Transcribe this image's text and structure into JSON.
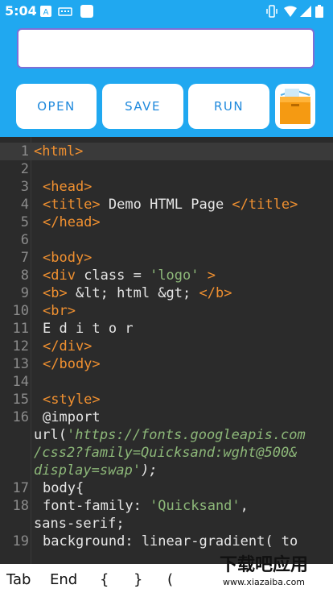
{
  "status": {
    "time": "5:04"
  },
  "url_input": {
    "value": "",
    "placeholder": ""
  },
  "buttons": [
    {
      "label": "OPEN"
    },
    {
      "label": "SAVE"
    },
    {
      "label": "RUN"
    }
  ],
  "editor": {
    "lines": [
      {
        "n": "1"
      },
      {
        "n": "2"
      },
      {
        "n": "3"
      },
      {
        "n": "4"
      },
      {
        "n": "5"
      },
      {
        "n": "6"
      },
      {
        "n": "7"
      },
      {
        "n": "8"
      },
      {
        "n": "9"
      },
      {
        "n": "10"
      },
      {
        "n": "11"
      },
      {
        "n": "12"
      },
      {
        "n": "13"
      },
      {
        "n": "14"
      },
      {
        "n": "15"
      },
      {
        "n": "16"
      },
      {
        "n": "17"
      },
      {
        "n": "18"
      },
      {
        "n": "19"
      }
    ],
    "code": {
      "l1": "<html>",
      "l3": "<head>",
      "l4a": "<title>",
      "l4b": " Demo HTML Page ",
      "l4c": "</title>",
      "l5": "</head>",
      "l7": "<body>",
      "l8a": "<div",
      "l8b": " class = ",
      "l8c": "'logo'",
      "l8d": " >",
      "l9a": "<b>",
      "l9b": " &lt; html &gt; ",
      "l9c": "</b>",
      "l10": "<br>",
      "l11": "E d i t o r",
      "l12": "</div>",
      "l13": "</body>",
      "l15": "<style>",
      "l16a": "@import",
      "l16b": "url(",
      "l16c": "'https://fonts.googleapis.com",
      "l16d": "/css2?family=Quicksand:wght@500&",
      "l16e": "display=swap'",
      "l16f": ");",
      "l17": "body{",
      "l18a": "font-family: ",
      "l18b": "'Quicksand'",
      "l18c": ",",
      "l18d": "sans-serif;",
      "l19": "background: linear-gradient( to"
    }
  },
  "keys": [
    {
      "label": "Tab"
    },
    {
      "label": "End"
    },
    {
      "label": "{"
    },
    {
      "label": "}"
    },
    {
      "label": "("
    }
  ],
  "watermark": {
    "title": "下载吧应用",
    "url": "www.xiazaiba.com"
  },
  "colors": {
    "accent": "#20a8f0",
    "tag": "#f09030",
    "string": "#8db879",
    "button_text": "#1d88dc"
  }
}
